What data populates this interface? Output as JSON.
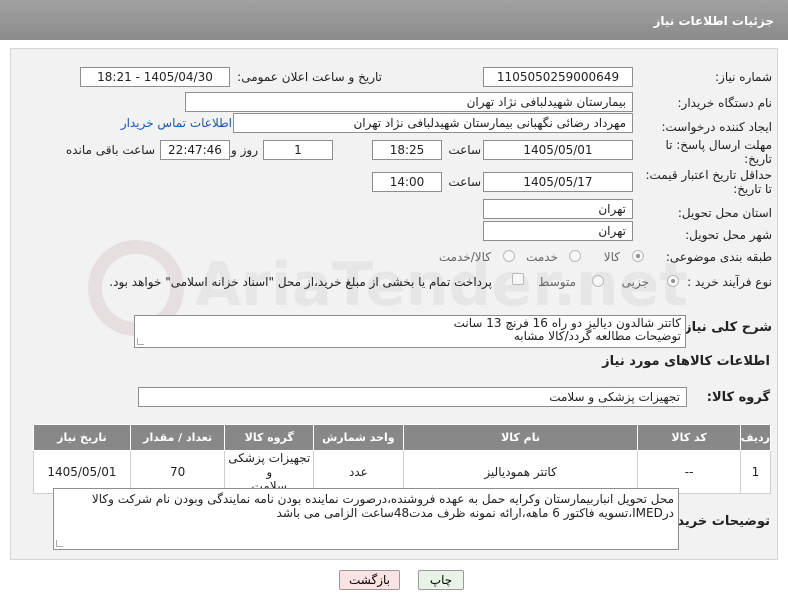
{
  "header": {
    "title": "جزئیات اطلاعات نیاز"
  },
  "form": {
    "need_number_label": "شماره نیاز:",
    "need_number": "1105050259000649",
    "announce_label": "تاریخ و ساعت اعلان عمومی:",
    "announce_value": "1405/04/30 - 18:21",
    "buyer_org_label": "نام دستگاه خریدار:",
    "buyer_org": "بیمارستان شهیدلبافی نژاد تهران",
    "requester_label": "ایجاد کننده درخواست:",
    "requester": "مهرداد رضائی نگهبانی بیمارستان شهیدلبافی نژاد تهران",
    "contact_link": "اطلاعات تماس خریدار",
    "deadline_label_1": "مهلت ارسال پاسخ: تا",
    "deadline_label_2": "تاریخ:",
    "deadline_date": "1405/05/01",
    "time_label": "ساعت",
    "deadline_time": "18:25",
    "days_value": "1",
    "days_label": "روز و",
    "remaining_time": "22:47:46",
    "remaining_label": "ساعت باقی مانده",
    "validity_label_1": "حداقل تاریخ اعتبار قیمت:",
    "validity_label_2": "تا تاریخ:",
    "validity_date": "1405/05/17",
    "validity_time": "14:00",
    "province_label": "استان محل تحویل:",
    "province": "تهران",
    "city_label": "شهر محل تحویل:",
    "city": "تهران",
    "category_label": "طبقه بندی موضوعی:",
    "category_options": [
      "کالا",
      "خدمت",
      "کالا/خدمت"
    ],
    "process_label": "نوع فرآیند خرید :",
    "process_options": [
      "جزیی",
      "متوسط"
    ],
    "payment_note": "پرداخت تمام یا بخشی از مبلغ خرید،از محل \"اسناد خزانه اسلامی\" خواهد بود.",
    "summary_label": "شرح کلی نیاز:",
    "summary_line1": "کاتتر شالدون دیالیز دو راه 16 فرنچ 13 سانت",
    "summary_line2": "توضیحات مطالعه گردد/کالا مشابه",
    "goods_info_title": "اطلاعات کالاهای مورد نیاز",
    "goods_group_label": "گروه کالا:",
    "goods_group": "تجهیزات پزشکی و سلامت",
    "buyer_notes_label": "توضیحات خریدار:",
    "buyer_notes_line1": "محل تحویل انباربیمارستان وکرایه حمل به عهده فروشنده،درصورت نماینده بودن نامه نمایندگی وبودن نام شرکت وکالا",
    "buyer_notes_line2": "درIMED،تسویه فاکتور 6 ماهه،ارائه نمونه ظرف مدت48ساعت الزامی می باشد"
  },
  "table": {
    "headers": [
      "ردیف",
      "کد کالا",
      "نام کالا",
      "واحد شمارش",
      "گروه کالا",
      "تعداد / مقدار",
      "تاریخ نیاز"
    ],
    "rows": [
      {
        "row": "1",
        "code": "--",
        "name": "کاتتر همودیالیز",
        "unit": "عدد",
        "group_l1": "تجهیزات پزشکی و",
        "group_l2": "سلامت",
        "qty": "70",
        "date": "1405/05/01"
      }
    ]
  },
  "buttons": {
    "print": "چاپ",
    "back": "بازگشت"
  },
  "watermark": {
    "text": "AriaTender.net"
  }
}
